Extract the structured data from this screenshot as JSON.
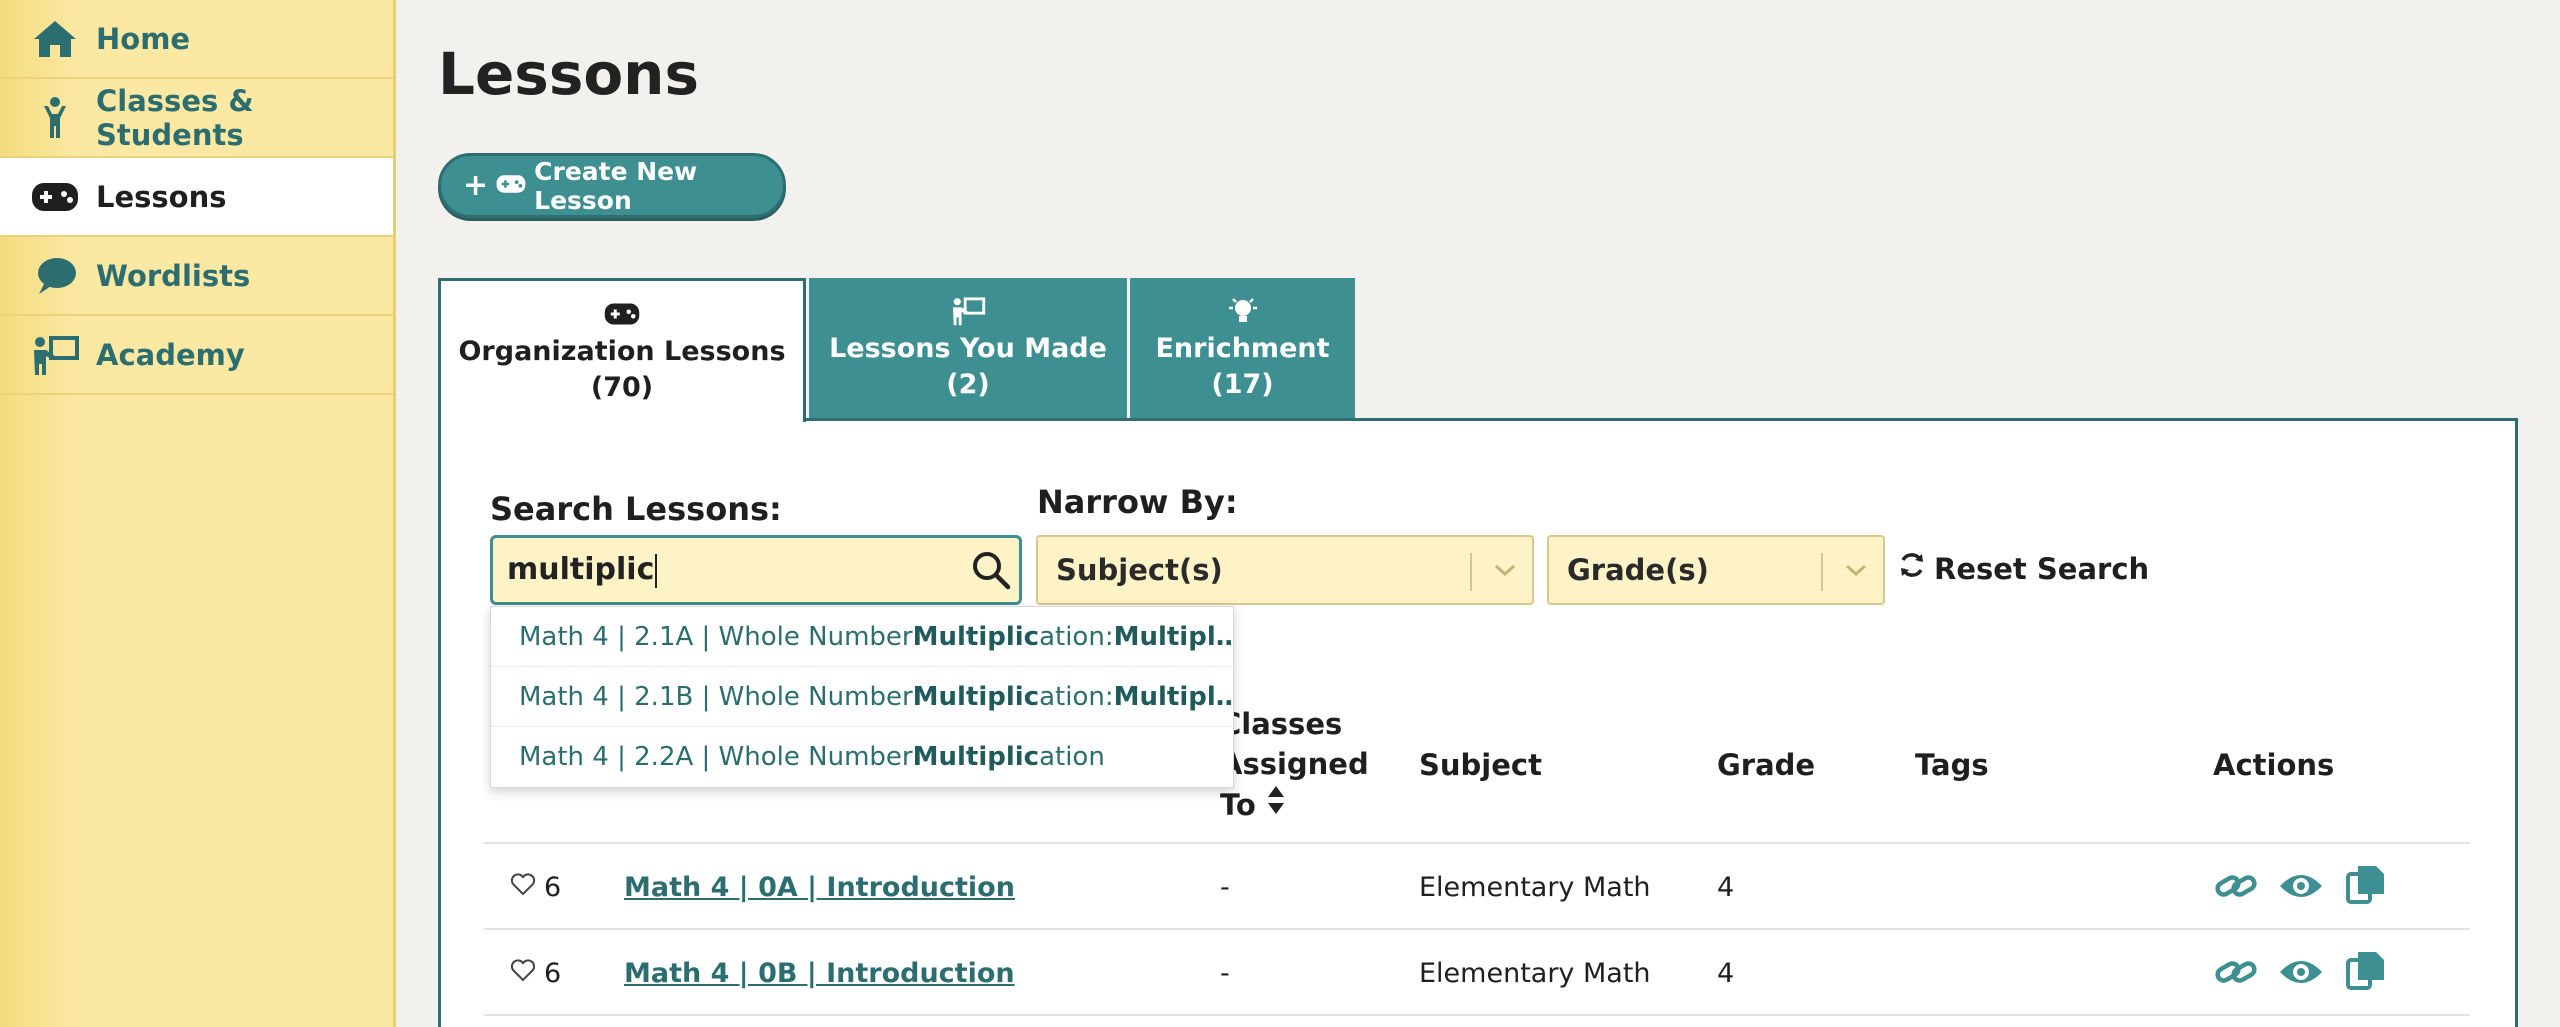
{
  "sidebar": {
    "items": [
      {
        "label": "Home",
        "icon": "house-icon",
        "active": false
      },
      {
        "label": "Classes & Students",
        "icon": "student-icon",
        "active": false
      },
      {
        "label": "Lessons",
        "icon": "gamepad-icon",
        "active": true
      },
      {
        "label": "Wordlists",
        "icon": "speech-bubble-icon",
        "active": false
      },
      {
        "label": "Academy",
        "icon": "teacher-board-icon",
        "active": false
      }
    ]
  },
  "page": {
    "title": "Lessons",
    "create_button": "Create New Lesson"
  },
  "tabs": [
    {
      "label": "Organization Lessons",
      "count": "(70)",
      "icon": "gamepad-icon"
    },
    {
      "label": "Lessons You Made",
      "count": "(2)",
      "icon": "teacher-board-icon"
    },
    {
      "label": "Enrichment",
      "count": "(17)",
      "icon": "lightbulb-icon"
    }
  ],
  "filters": {
    "search_label": "Search Lessons:",
    "search_value": "multiplic",
    "narrow_label": "Narrow By:",
    "subject_select": "Subject(s)",
    "grade_select": "Grade(s)",
    "reset_label": "Reset Search"
  },
  "suggestions": [
    {
      "prefix": "Math 4 | 2.1A | Whole Number ",
      "match": "Multiplic",
      "suffix": "ation: ",
      "match2": "Multipl…"
    },
    {
      "prefix": "Math 4 | 2.1B | Whole Number ",
      "match": "Multiplic",
      "suffix": "ation: ",
      "match2": "Multipl…"
    },
    {
      "prefix": "Math 4 | 2.2A | Whole Number ",
      "match": "Multiplic",
      "suffix": "ation",
      "match2": ""
    }
  ],
  "table": {
    "headers": {
      "classes_l1": "Classes",
      "classes_l2": "Assigned",
      "classes_l3": "To",
      "subject": "Subject",
      "grade": "Grade",
      "tags": "Tags",
      "actions": "Actions"
    },
    "rows": [
      {
        "likes": "6",
        "name": "Math 4 | 0A | Introduction",
        "classes": "-",
        "subject": "Elementary Math",
        "grade": "4",
        "tags": ""
      },
      {
        "likes": "6",
        "name": "Math 4 | 0B | Introduction",
        "classes": "-",
        "subject": "Elementary Math",
        "grade": "4",
        "tags": ""
      }
    ]
  },
  "colors": {
    "teal": "#3d8f91",
    "sidebar_yellow": "#fbe9a3",
    "input_yellow": "#fdf3c6"
  }
}
